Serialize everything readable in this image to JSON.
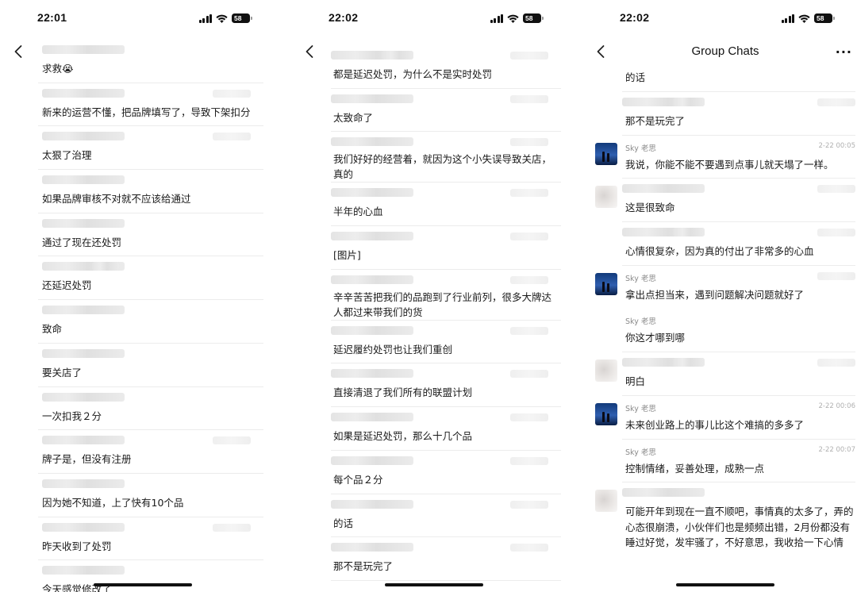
{
  "screens": [
    {
      "time": "22:01",
      "battery": "58",
      "messages": [
        {
          "text": "求救😭"
        },
        {
          "text": "新来的运营不懂，把品牌填写了，导致下架扣分"
        },
        {
          "text": "太狠了治理"
        },
        {
          "text": "如果品牌审核不对就不应该给通过"
        },
        {
          "text": "通过了现在还处罚"
        },
        {
          "text": "还延迟处罚"
        },
        {
          "text": "致命"
        },
        {
          "text": "要关店了"
        },
        {
          "text": "一次扣我２分"
        },
        {
          "text": "牌子是，但没有注册"
        },
        {
          "text": "因为她不知道，上了快有10个品"
        },
        {
          "text": "昨天收到了处罚"
        },
        {
          "text": "今天感觉修改了"
        }
      ]
    },
    {
      "time": "22:02",
      "battery": "58",
      "messages": [
        {
          "text": "都是延迟处罚，为什么不是实时处罚"
        },
        {
          "text": "太致命了"
        },
        {
          "text": "我们好好的经营着，就因为这个小失误导致关店，真的",
          "tall": true
        },
        {
          "text": "半年的心血"
        },
        {
          "text": "[图片]"
        },
        {
          "text": "辛辛苦苦把我们的品跑到了行业前列，很多大牌达人都过来带我们的货",
          "tall": true
        },
        {
          "text": "延迟履约处罚也让我们重创"
        },
        {
          "text": "直接清退了我们所有的联盟计划"
        },
        {
          "text": "如果是延迟处罚，那么十几个品"
        },
        {
          "text": "每个品２分"
        },
        {
          "text": "的话"
        },
        {
          "text": "那不是玩完了"
        }
      ]
    },
    {
      "time": "22:02",
      "battery": "58",
      "title": "Group Chats",
      "top_partial": "的话",
      "messages": [
        {
          "avatar": "none",
          "text": "那不是玩完了"
        },
        {
          "avatar": "sky",
          "name": "Sky 老思",
          "time": "2-22 00:05",
          "text": "我说，你能不能不要遇到点事儿就天塌了一样。"
        },
        {
          "avatar": "blur",
          "text": "这是很致命"
        },
        {
          "avatar": "none",
          "text": "心情很复杂，因为真的付出了非常多的心血"
        },
        {
          "avatar": "sky",
          "name": "Sky 老思",
          "text": "拿出点担当来，遇到问题解决问题就好了"
        },
        {
          "avatar": "none",
          "name": "Sky 老思",
          "text": "你这才哪到哪"
        },
        {
          "avatar": "blur",
          "text": "明白"
        },
        {
          "avatar": "sky",
          "name": "Sky 老思",
          "time": "2-22 00:06",
          "text": "未来创业路上的事儿比这个难搞的多多了"
        },
        {
          "avatar": "none",
          "name": "Sky 老思",
          "time": "2-22 00:07",
          "text": "控制情绪，妥善处理，成熟一点"
        },
        {
          "avatar": "blur",
          "text": "可能开年到现在一直不顺吧，事情真的太多了，弄的心态很崩溃，小伙伴们也是频频出错，2月份都没有睡过好觉，发牢骚了，不好意思，我收拾一下心情"
        }
      ]
    }
  ]
}
